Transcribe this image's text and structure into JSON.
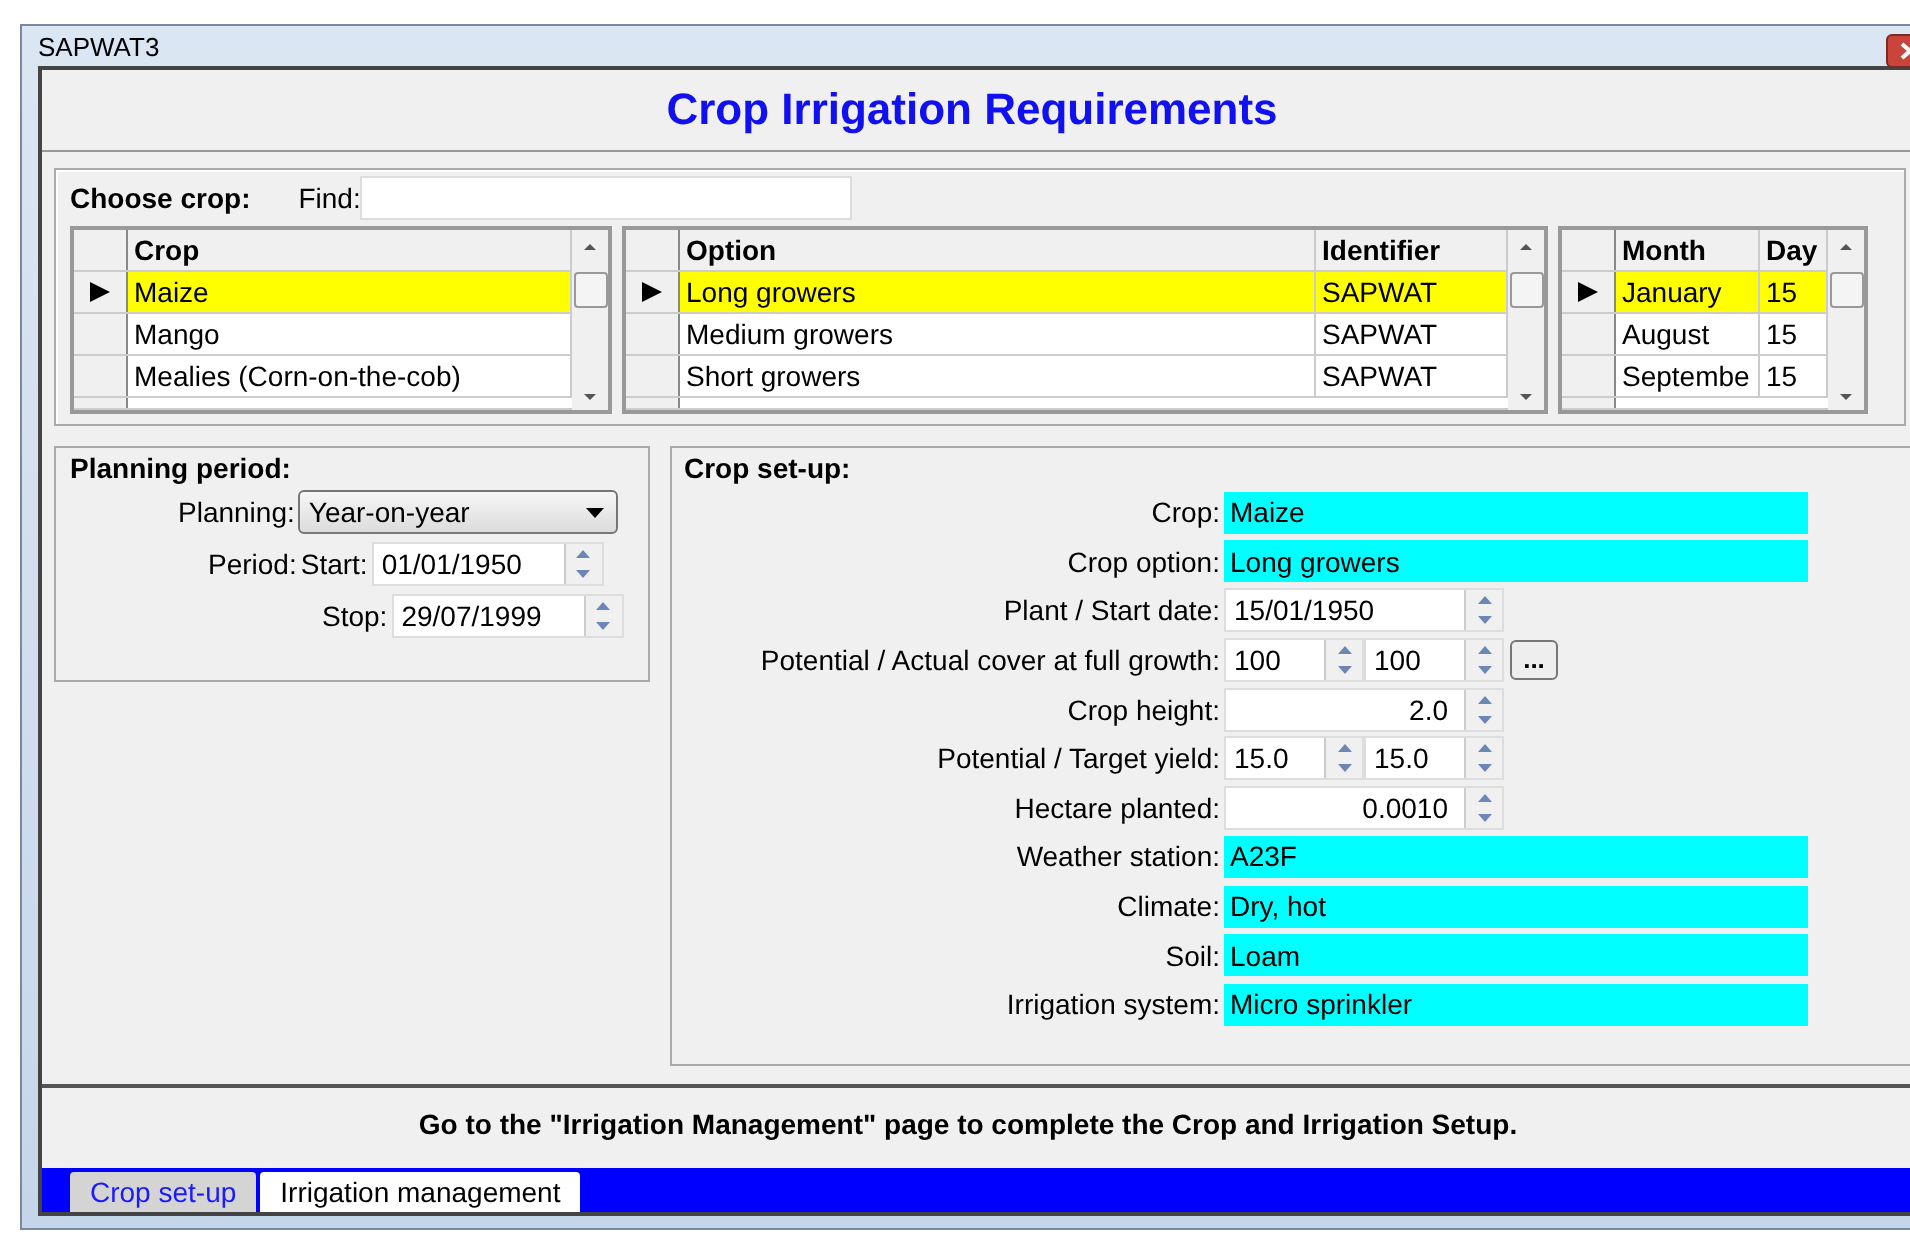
{
  "window": {
    "title": "SAPWAT3"
  },
  "heading": "Crop Irrigation Requirements",
  "choose_crop": {
    "label": "Choose crop:",
    "find_label": "Find:",
    "grids": [
      {
        "columns": [
          "Crop"
        ],
        "rows": [
          {
            "cells": [
              "Maize"
            ],
            "selected": true
          },
          {
            "cells": [
              "Mango"
            ],
            "selected": false
          },
          {
            "cells": [
              "Mealies (Corn-on-the-cob)"
            ],
            "selected": false
          }
        ]
      },
      {
        "columns": [
          "Option",
          "Identifier"
        ],
        "rows": [
          {
            "cells": [
              "Long growers",
              "SAPWAT"
            ],
            "selected": true
          },
          {
            "cells": [
              "Medium growers",
              "SAPWAT"
            ],
            "selected": false
          },
          {
            "cells": [
              "Short growers",
              "SAPWAT"
            ],
            "selected": false
          }
        ]
      },
      {
        "columns": [
          "Month",
          "Day"
        ],
        "rows": [
          {
            "cells": [
              "January",
              "15"
            ],
            "selected": true
          },
          {
            "cells": [
              "August",
              "15"
            ],
            "selected": false
          },
          {
            "cells": [
              "Septembe",
              "15"
            ],
            "selected": false
          }
        ]
      }
    ]
  },
  "planning_period": {
    "title": "Planning period:",
    "planning_label": "Planning:",
    "planning_value": "Year-on-year",
    "period_label": "Period:",
    "start_label": "Start:",
    "start": "01/01/1950",
    "stop_label": "Stop:",
    "stop": "29/07/1999"
  },
  "crop_setup": {
    "title": "Crop set-up:",
    "fields": [
      {
        "kind": "display",
        "label": "Crop:",
        "value": "Maize"
      },
      {
        "kind": "display",
        "label": "Crop option:",
        "value": "Long growers"
      },
      {
        "kind": "date",
        "label": "Plant / Start date:",
        "value": "15/01/1950"
      },
      {
        "kind": "pair",
        "label": "Potential / Actual cover at full growth:",
        "values": [
          "100",
          "100"
        ],
        "button": "..."
      },
      {
        "kind": "number",
        "label": "Crop height:",
        "value": "2.0"
      },
      {
        "kind": "pair",
        "label": "Potential / Target yield:",
        "values": [
          "15.0",
          "15.0"
        ]
      },
      {
        "kind": "number",
        "label": "Hectare planted:",
        "value": "0.0010"
      },
      {
        "kind": "display",
        "label": "Weather station:",
        "value": "A23F"
      },
      {
        "kind": "display",
        "label": "Climate:",
        "value": "Dry, hot"
      },
      {
        "kind": "display",
        "label": "Soil:",
        "value": "Loam"
      },
      {
        "kind": "display",
        "label": "Irrigation system:",
        "value": "Micro sprinkler"
      }
    ]
  },
  "message": "Go to the \"Irrigation Management\" page to complete the Crop and Irrigation Setup.",
  "tabs": [
    {
      "label": "Crop set-up",
      "selected": true
    },
    {
      "label": "Irrigation management",
      "selected": false
    }
  ]
}
